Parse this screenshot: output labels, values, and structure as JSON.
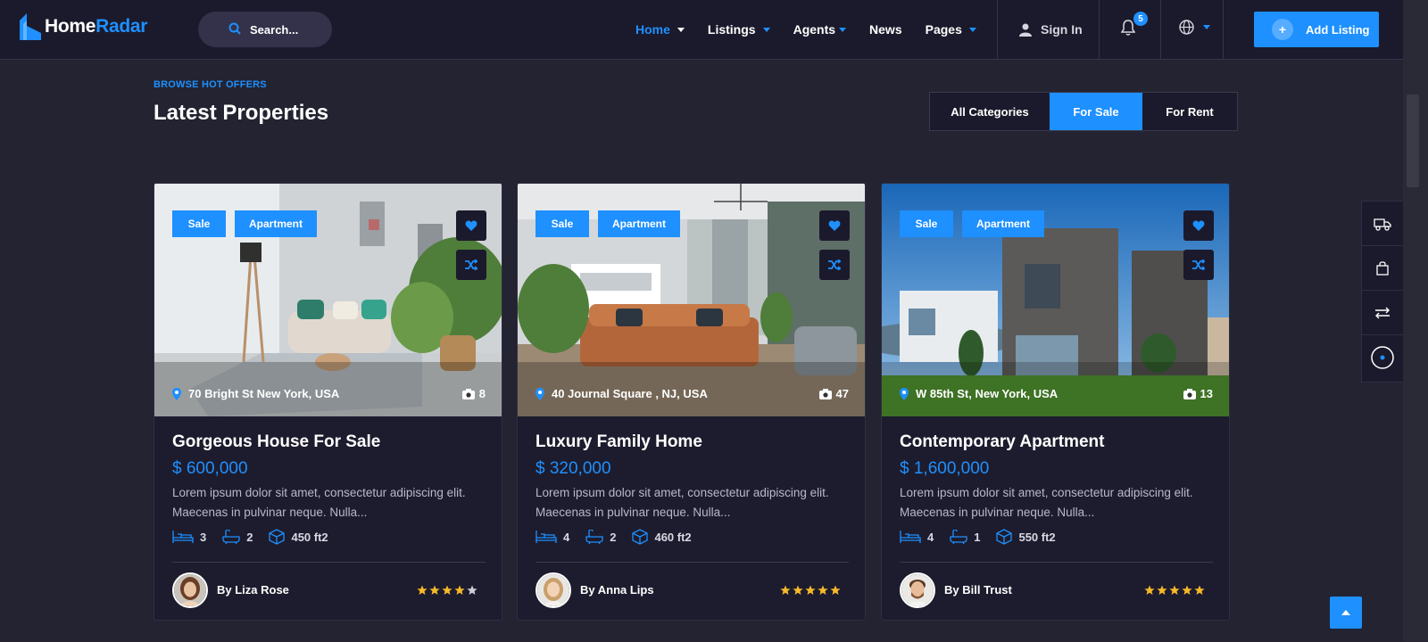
{
  "header": {
    "logo": {
      "part1": "Home",
      "part2": "Radar"
    },
    "search_label": "Search...",
    "nav": [
      {
        "label": "Home",
        "dropdown": true,
        "active": true
      },
      {
        "label": "Listings",
        "dropdown": true
      },
      {
        "label": "Agents",
        "dropdown": true
      },
      {
        "label": "News",
        "dropdown": false
      },
      {
        "label": "Pages",
        "dropdown": true
      }
    ],
    "sign_in": "Sign In",
    "notification_count": "5",
    "add_listing": "Add Listing",
    "accent_color": "#1e90ff"
  },
  "section": {
    "eyebrow": "BROWSE HOT OFFERS",
    "title": "Latest Properties",
    "filters": [
      {
        "label": "All Categories",
        "active": false
      },
      {
        "label": "For Sale",
        "active": true
      },
      {
        "label": "For Rent",
        "active": false
      }
    ]
  },
  "properties": [
    {
      "tags": [
        "Sale",
        "Apartment"
      ],
      "address": "70 Bright St New York, USA",
      "photos": "8",
      "title": "Gorgeous House For Sale",
      "price": "$ 600,000",
      "description": "Lorem ipsum dolor sit amet, consectetur adipiscing elit. Maecenas in pulvinar neque. Nulla...",
      "beds": "3",
      "baths": "2",
      "area": "450 ft2",
      "author": "By Liza Rose",
      "rating": 4
    },
    {
      "tags": [
        "Sale",
        "Apartment"
      ],
      "address": "40 Journal Square , NJ, USA",
      "photos": "47",
      "title": "Luxury Family Home",
      "price": "$ 320,000",
      "description": "Lorem ipsum dolor sit amet, consectetur adipiscing elit. Maecenas in pulvinar neque. Nulla...",
      "beds": "4",
      "baths": "2",
      "area": "460 ft2",
      "author": "By Anna Lips",
      "rating": 5
    },
    {
      "tags": [
        "Sale",
        "Apartment"
      ],
      "address": "W 85th St, New York, USA",
      "photos": "13",
      "title": "Contemporary Apartment",
      "price": "$ 1,600,000",
      "description": "Lorem ipsum dolor sit amet, consectetur adipiscing elit. Maecenas in pulvinar neque. Nulla...",
      "beds": "4",
      "baths": "1",
      "area": "550 ft2",
      "author": "By Bill Trust",
      "rating": 5
    }
  ],
  "side_panel": [
    "truck-icon",
    "shopping-bag-icon",
    "compare-icon",
    "loading-icon"
  ]
}
